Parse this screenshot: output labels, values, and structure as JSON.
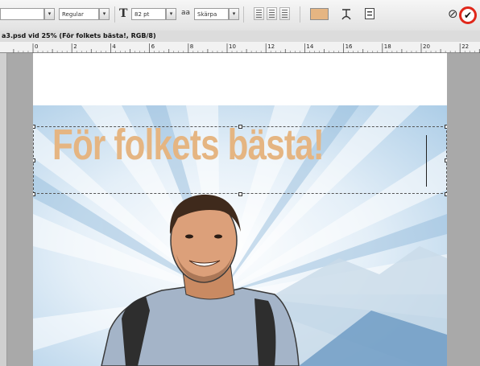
{
  "options_bar": {
    "font_style": "Regular",
    "font_size": "82 pt",
    "aa_icon": "aa",
    "antialias": "Skärpa",
    "text_color": "#e5b582",
    "cancel_glyph": "⊘",
    "commit_glyph": "✔"
  },
  "document": {
    "title": "a3.psd vid 25% (För folkets bästa!, RGB/8)"
  },
  "ruler": {
    "labels": [
      "0",
      "2",
      "4",
      "6",
      "8",
      "10",
      "12",
      "14",
      "16",
      "18",
      "20",
      "22"
    ]
  },
  "canvas": {
    "headline": "För folkets bästa!"
  }
}
